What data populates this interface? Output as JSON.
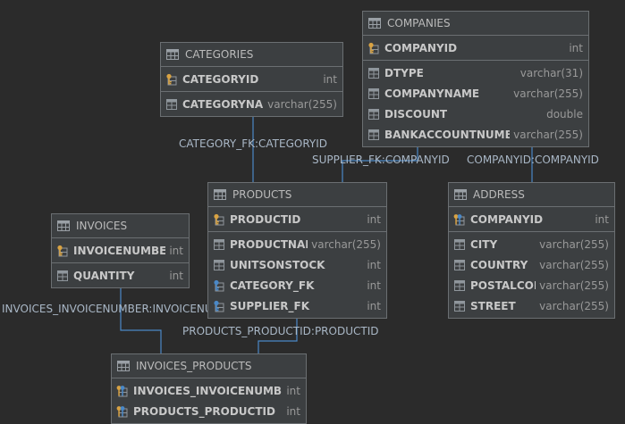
{
  "relationships": [
    {
      "label": "CATEGORY_FK:CATEGORYID"
    },
    {
      "label": "SUPPLIER_FK:COMPANYID"
    },
    {
      "label": "COMPANYID:COMPANYID"
    },
    {
      "label": "INVOICES_INVOICENUMBER:INVOICENUMBER"
    },
    {
      "label": "PRODUCTS_PRODUCTID:PRODUCTID"
    }
  ],
  "entities": {
    "companies": {
      "title": "COMPANIES",
      "pk": [
        {
          "name": "COMPANYID",
          "type": "int",
          "icon": "pk-key-icon"
        }
      ],
      "cols": [
        {
          "name": "DTYPE",
          "type": "varchar(31)",
          "icon": "column-icon"
        },
        {
          "name": "COMPANYNAME",
          "type": "varchar(255)",
          "icon": "column-icon"
        },
        {
          "name": "DISCOUNT",
          "type": "double",
          "icon": "column-icon"
        },
        {
          "name": "BANKACCOUNTNUMBER",
          "type": "varchar(255)",
          "icon": "column-icon"
        }
      ]
    },
    "categories": {
      "title": "CATEGORIES",
      "pk": [
        {
          "name": "CATEGORYID",
          "type": "int",
          "icon": "pk-key-icon"
        }
      ],
      "cols": [
        {
          "name": "CATEGORYNAME",
          "type": "varchar(255)",
          "icon": "column-icon"
        }
      ]
    },
    "products": {
      "title": "PRODUCTS",
      "pk": [
        {
          "name": "PRODUCTID",
          "type": "int",
          "icon": "pk-key-icon"
        }
      ],
      "cols": [
        {
          "name": "PRODUCTNAME",
          "type": "varchar(255)",
          "icon": "column-icon"
        },
        {
          "name": "UNITSONSTOCK",
          "type": "int",
          "icon": "column-icon"
        },
        {
          "name": "CATEGORY_FK",
          "type": "int",
          "icon": "fk-key-icon"
        },
        {
          "name": "SUPPLIER_FK",
          "type": "int",
          "icon": "fk-key-icon"
        }
      ]
    },
    "address": {
      "title": "ADDRESS",
      "pk": [
        {
          "name": "COMPANYID",
          "type": "int",
          "icon": "pk-fk-key-icon"
        }
      ],
      "cols": [
        {
          "name": "CITY",
          "type": "varchar(255)",
          "icon": "column-icon"
        },
        {
          "name": "COUNTRY",
          "type": "varchar(255)",
          "icon": "column-icon"
        },
        {
          "name": "POSTALCODE",
          "type": "varchar(255)",
          "icon": "column-icon"
        },
        {
          "name": "STREET",
          "type": "varchar(255)",
          "icon": "column-icon"
        }
      ]
    },
    "invoices": {
      "title": "INVOICES",
      "pk": [
        {
          "name": "INVOICENUMBER",
          "type": "int",
          "icon": "pk-key-icon"
        }
      ],
      "cols": [
        {
          "name": "QUANTITY",
          "type": "int",
          "icon": "column-icon"
        }
      ]
    },
    "invoices_products": {
      "title": "INVOICES_PRODUCTS",
      "pk": [
        {
          "name": "INVOICES_INVOICENUMBER",
          "type": "int",
          "icon": "pk-fk-key-icon"
        },
        {
          "name": "PRODUCTS_PRODUCTID",
          "type": "int",
          "icon": "pk-fk-key-icon"
        }
      ],
      "cols": []
    }
  },
  "colors": {
    "background": "#2b2b2b",
    "entity_bg": "#3c3f41",
    "entity_border": "#6b6f72",
    "link": "#4a88c7",
    "pk_key": "#d9a343",
    "fk_key": "#4a88c7"
  }
}
